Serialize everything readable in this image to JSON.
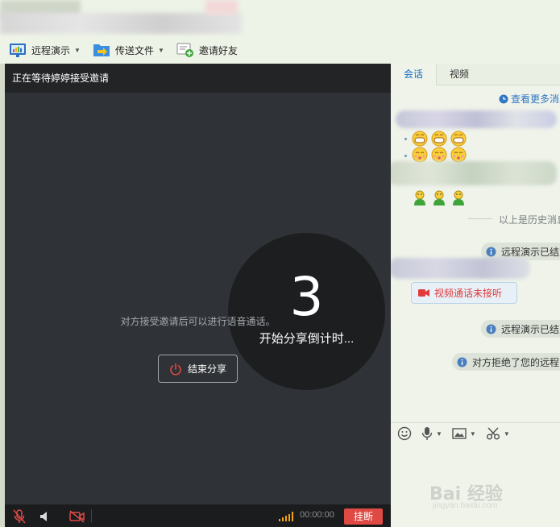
{
  "toolbar": {
    "remote_demo": "远程演示",
    "send_file": "传送文件",
    "invite_friend": "邀请好友"
  },
  "main": {
    "header": "正在等待婷婷接受邀请",
    "countdown_number": "3",
    "countdown_caption": "开始分享倒计时...",
    "hint": "对方接受邀请后可以进行语音通话。",
    "end_share": "结束分享",
    "timer": "00:00:00",
    "hangup": "挂断"
  },
  "chat": {
    "tabs": [
      "会话",
      "视频"
    ],
    "more_messages": "查看更多消息",
    "history_label": "以上是历史消息",
    "remote_ended_1": "远程演示已结束",
    "video_missed": "视频通话未接听",
    "remote_ended_2": "远程演示已结束",
    "peer_declined": "对方拒绝了您的远程"
  },
  "watermark": {
    "brand": "Bai 经验",
    "url": "jingyan.baidu.com"
  },
  "colors": {
    "accent_blue": "#1d6fc4",
    "hangup_red": "#e04a45",
    "missed_red": "#e13a3a",
    "signal_orange": "#f2a316"
  }
}
